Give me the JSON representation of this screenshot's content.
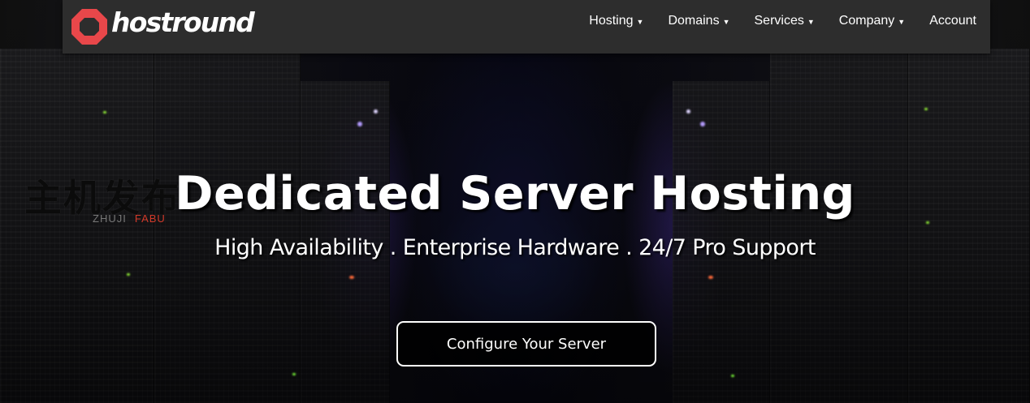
{
  "brand": {
    "name": "hostround",
    "logo_icon": "octagon-ring-logo",
    "accent_color": "#e8474a"
  },
  "nav": {
    "items": [
      {
        "label": "Hosting",
        "has_dropdown": true,
        "icon": "caret-down-icon"
      },
      {
        "label": "Domains",
        "has_dropdown": true,
        "icon": "caret-down-icon"
      },
      {
        "label": "Services",
        "has_dropdown": true,
        "icon": "caret-down-icon"
      },
      {
        "label": "Company",
        "has_dropdown": true,
        "icon": "caret-down-icon"
      },
      {
        "label": "Account",
        "has_dropdown": false
      }
    ],
    "background_color": "#2d2d2d"
  },
  "watermark": {
    "cn_text": "主机发布",
    "latin_part1": "ZHUJI",
    "latin_part2": "FABU"
  },
  "hero": {
    "title": "Dedicated Server Hosting",
    "subtitle": "High Availability . Enterprise Hardware . 24/7 Pro Support",
    "cta_label": "Configure Your Server",
    "background": "server-room-photo"
  }
}
